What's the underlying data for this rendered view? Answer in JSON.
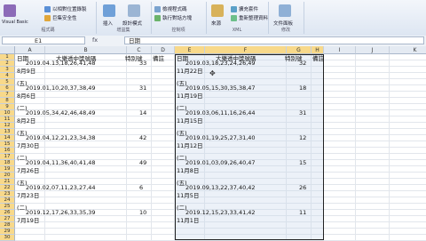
{
  "ribbon": {
    "groups": [
      {
        "label": "程式碼",
        "big": "Visual Basic",
        "items": [
          "以相對位置錄製",
          "巨集安全性"
        ]
      },
      {
        "label": "增益集",
        "big": "插入",
        "items": [
          "設計模式"
        ]
      },
      {
        "label": "控制項",
        "big": "",
        "items": [
          "檢視程式碼",
          "執行對話方塊"
        ]
      },
      {
        "label": "XML",
        "big": "來源",
        "items": [
          "擴充套件",
          "重新整理資料"
        ]
      },
      {
        "label": "修改",
        "big": "文件面板",
        "items": []
      }
    ]
  },
  "formula_bar": {
    "name_box": "E1",
    "fx": "fx",
    "formula": "日期"
  },
  "columns": [
    "A",
    "B",
    "C",
    "D",
    "E",
    "F",
    "G",
    "H",
    "I",
    "J",
    "K"
  ],
  "selected_columns": [
    "E",
    "F",
    "G",
    "H"
  ],
  "rows": [
    "1",
    "2",
    "3",
    "4",
    "5",
    "6",
    "7",
    "8",
    "9",
    "10",
    "11",
    "12",
    "13",
    "14",
    "15",
    "16",
    "17",
    "18",
    "19",
    "20",
    "21",
    "22",
    "23",
    "24",
    "25",
    "26",
    "27",
    "28",
    "29",
    "30"
  ],
  "left_table": {
    "headers": {
      "date": "日期",
      "numbers": "大樂透中獎號碼",
      "special": "特別號",
      "note": "備註"
    },
    "records": [
      {
        "draw": "2019.04.13,18,26,41,48",
        "special": "33",
        "date": "8月9日",
        "weekday": "(五)"
      },
      {
        "draw": "2019.01,10,20,37,38,49",
        "special": "31",
        "date": "8月6日",
        "weekday": "(二)"
      },
      {
        "draw": "2019.05,34,42,46,48,49",
        "special": "14",
        "date": "8月2日",
        "weekday": "(五)"
      },
      {
        "draw": "2019.04,12,21,23,34,38",
        "special": "42",
        "date": "7月30日",
        "weekday": "(二)"
      },
      {
        "draw": "2019.04,11,36,40,41,48",
        "special": "49",
        "date": "7月26日",
        "weekday": "(五)"
      },
      {
        "draw": "2019.02,07,11,23,27,44",
        "special": "6",
        "date": "7月23日",
        "weekday": "(二)"
      },
      {
        "draw": "2019.12,17,26,33,35,39",
        "special": "10",
        "date": "7月19日",
        "weekday": ""
      }
    ]
  },
  "right_table": {
    "headers": {
      "date": "日期",
      "numbers": "大樂透中獎號碼",
      "special": "特別號",
      "note": "備註"
    },
    "records": [
      {
        "draw": "2019.03,18,23,24,26,49",
        "special": "32",
        "date": "11月22日",
        "weekday": "(五)"
      },
      {
        "draw": "2019.05,15,30,35,38,47",
        "special": "18",
        "date": "11月19日",
        "weekday": "(二)"
      },
      {
        "draw": "2019.03,06,11,16,26,44",
        "special": "31",
        "date": "11月15日",
        "weekday": "(五)"
      },
      {
        "draw": "2019.01,19,25,27,31,40",
        "special": "12",
        "date": "11月12日",
        "weekday": "(二)"
      },
      {
        "draw": "2019.01,03,09,26,40,47",
        "special": "15",
        "date": "11月8日",
        "weekday": "(五)"
      },
      {
        "draw": "2019.09,13,22,37,40,42",
        "special": "26",
        "date": "11月5日",
        "weekday": "(二)"
      },
      {
        "draw": "2019.12,15,23,33,41,42",
        "special": "11",
        "date": "11月1日",
        "weekday": ""
      }
    ]
  }
}
